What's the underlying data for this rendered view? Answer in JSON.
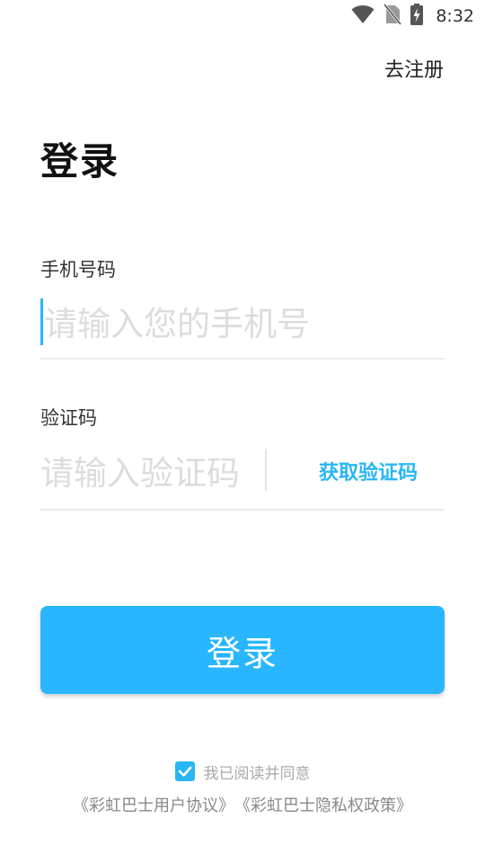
{
  "status_bar": {
    "time": "8:32",
    "icons": [
      "wifi-icon",
      "no-sim-icon",
      "battery-charging-icon"
    ]
  },
  "header": {
    "register_label": "去注册"
  },
  "page": {
    "title": "登录"
  },
  "phone": {
    "label": "手机号码",
    "placeholder": "请输入您的手机号",
    "value": ""
  },
  "code": {
    "label": "验证码",
    "placeholder": "请输入验证码",
    "value": "",
    "get_code_label": "获取验证码"
  },
  "login_button": {
    "label": "登录"
  },
  "agreement": {
    "checked": true,
    "text": "我已阅读并同意",
    "user_agreement": "《彩虹巴士用户协议》",
    "privacy_policy": "《彩虹巴士隐私权政策》"
  },
  "colors": {
    "accent": "#29b6f6",
    "button": "#29b6fe",
    "text": "#222222",
    "placeholder": "#dcdcdc",
    "muted": "#aaaaaa"
  }
}
